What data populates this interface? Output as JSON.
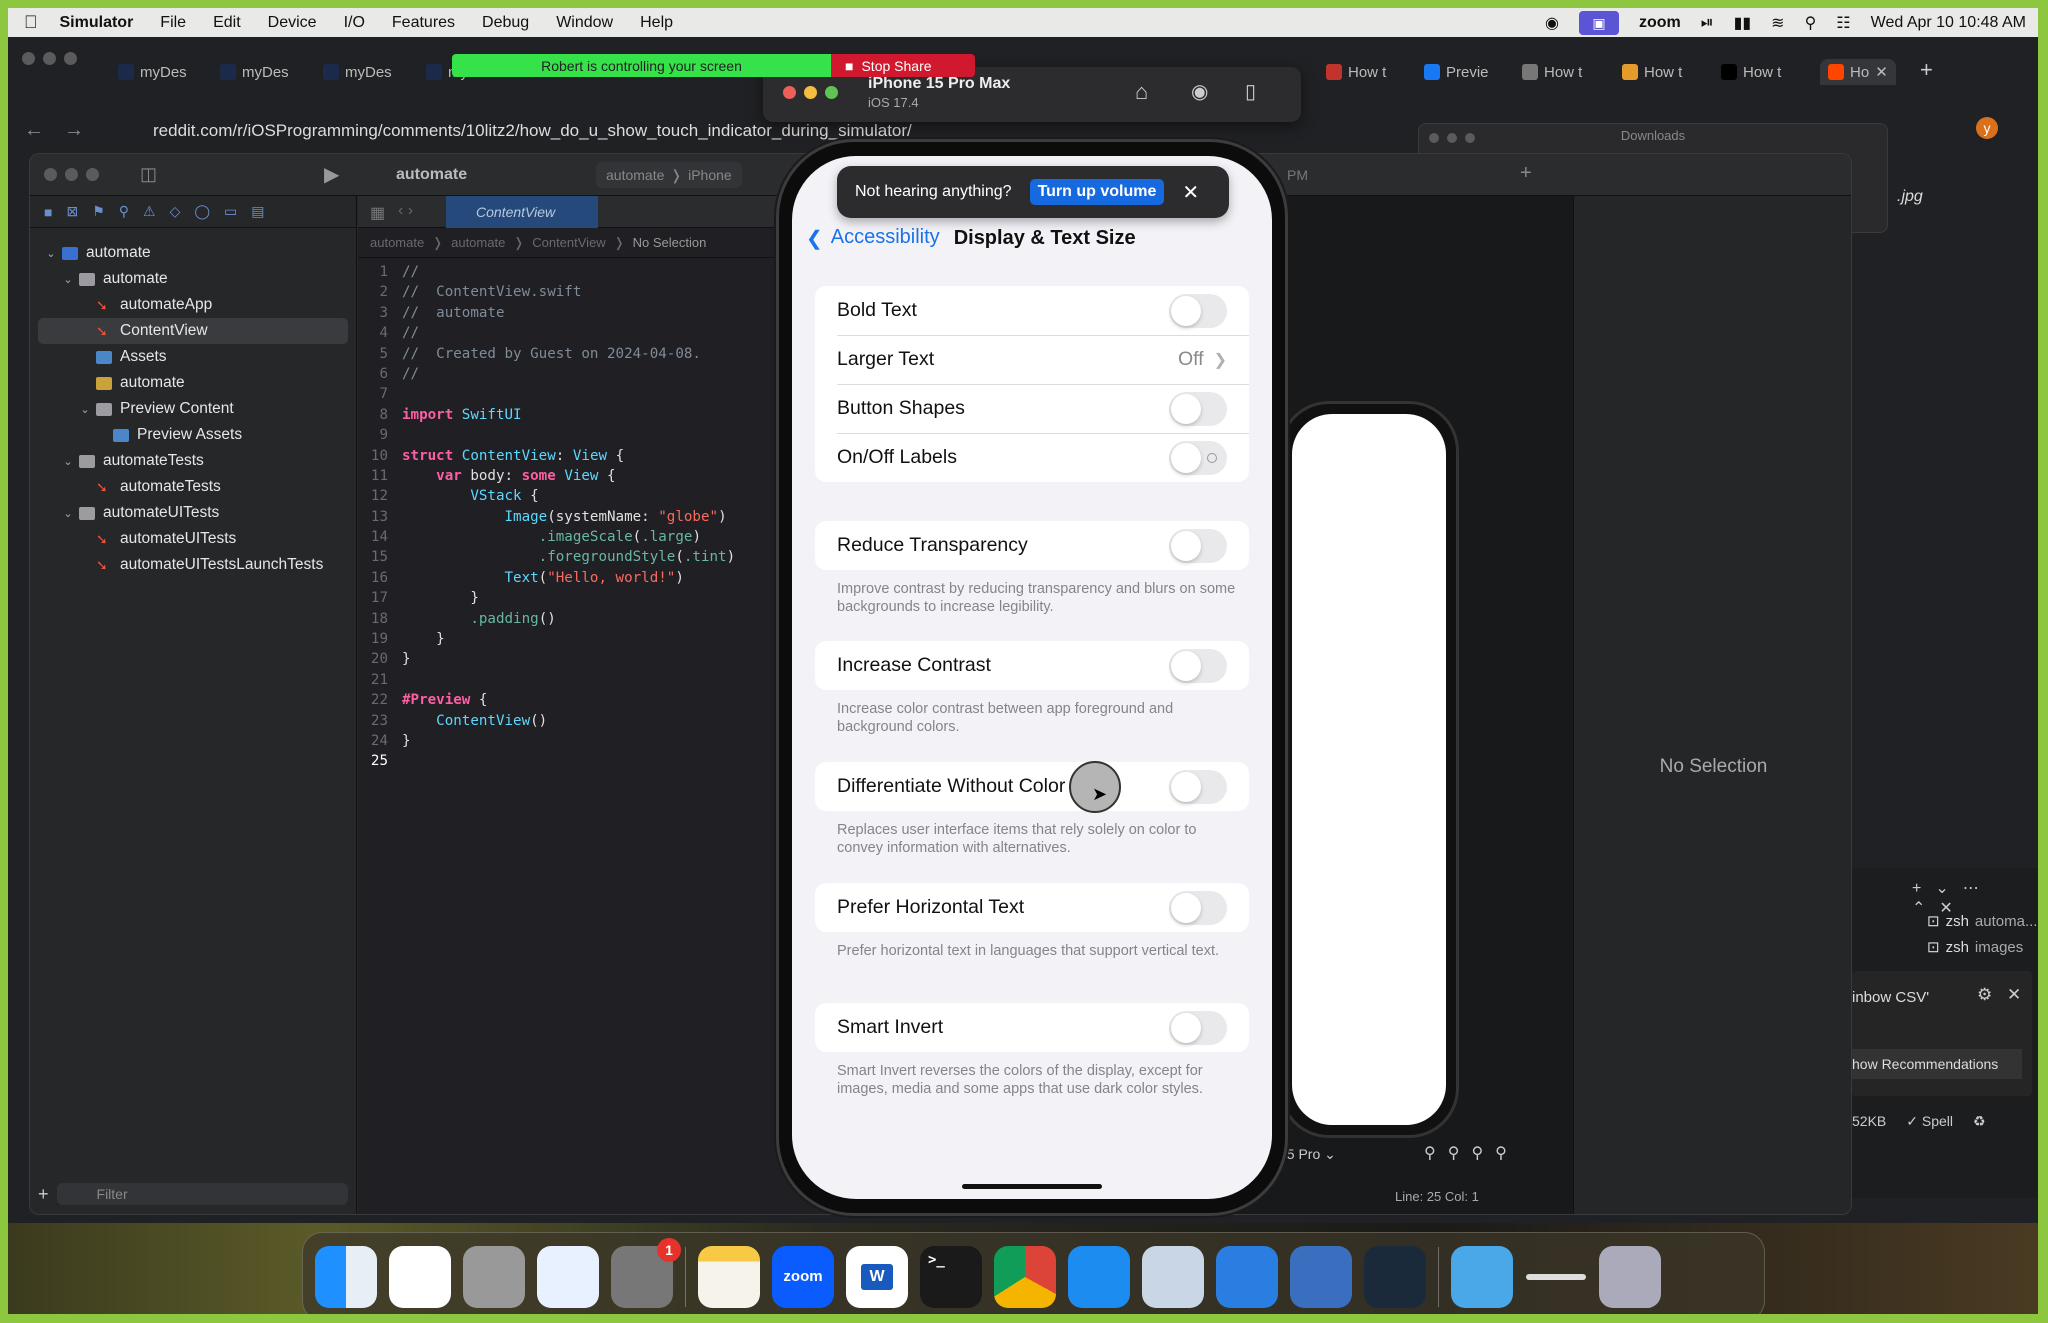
{
  "menubar": {
    "app": "Simulator",
    "items": [
      "File",
      "Edit",
      "Device",
      "I/O",
      "Features",
      "Debug",
      "Window",
      "Help"
    ],
    "zoom_label": "zoom",
    "datetime": "Wed Apr 10  10:48 AM"
  },
  "zoom_share": {
    "message": "Robert is controlling your screen",
    "stop": "Stop Share",
    "color": "#35e24a",
    "stop_color": "#d0192e"
  },
  "browser": {
    "tabs_left": [
      "myDes",
      "myDes",
      "myDes",
      "myDes"
    ],
    "tabs_right": [
      "How t",
      "Previe",
      "How t",
      "How t",
      "How t",
      "Ho"
    ],
    "url": "reddit.com/r/iOSProgramming/comments/10litz2/how_do_u_show_touch_indicator_during_simulator/",
    "new_tab": "+",
    "profile": "y"
  },
  "downloads": {
    "title": "Downloads",
    "file": ".jpg"
  },
  "simulator": {
    "device": "iPhone 15 Pro Max",
    "os": "iOS 17.4"
  },
  "xcode": {
    "project": "automate",
    "scheme": "automate",
    "destination": "iPhone",
    "status_time": "PM",
    "editor_tab": "ContentView",
    "breadcrumb": [
      "automate",
      "automate",
      "ContentView",
      "No Selection"
    ],
    "filter_placeholder": "Filter",
    "navigator": [
      {
        "name": "automate",
        "depth": 0,
        "type": "proj",
        "expanded": true
      },
      {
        "name": "automate",
        "depth": 1,
        "type": "folder",
        "expanded": true
      },
      {
        "name": "automateApp",
        "depth": 2,
        "type": "swift"
      },
      {
        "name": "ContentView",
        "depth": 2,
        "type": "swift",
        "selected": true
      },
      {
        "name": "Assets",
        "depth": 2,
        "type": "assets"
      },
      {
        "name": "automate",
        "depth": 2,
        "type": "ent"
      },
      {
        "name": "Preview Content",
        "depth": 2,
        "type": "folder",
        "expanded": true
      },
      {
        "name": "Preview Assets",
        "depth": 3,
        "type": "assets"
      },
      {
        "name": "automateTests",
        "depth": 1,
        "type": "folder",
        "expanded": true
      },
      {
        "name": "automateTests",
        "depth": 2,
        "type": "swift"
      },
      {
        "name": "automateUITests",
        "depth": 1,
        "type": "folder",
        "expanded": true
      },
      {
        "name": "automateUITests",
        "depth": 2,
        "type": "swift"
      },
      {
        "name": "automateUITestsLaunchTests",
        "depth": 2,
        "type": "swift"
      }
    ],
    "code": [
      "//",
      "//  ContentView.swift",
      "//  automate",
      "//",
      "//  Created by Guest on 2024-04-08.",
      "//",
      "",
      "import SwiftUI",
      "",
      "struct ContentView: View {",
      "    var body: some View {",
      "        VStack {",
      "            Image(systemName: \"globe\")",
      "                .imageScale(.large)",
      "                .foregroundStyle(.tint)",
      "            Text(\"Hello, world!\")",
      "        }",
      "        .padding()",
      "    }",
      "}",
      "",
      "#Preview {",
      "    ContentView()",
      "}",
      ""
    ],
    "current_line": 25,
    "canvas_device": "15 Pro",
    "cursor_position": "Line: 25  Col: 1",
    "inspector": "No Selection"
  },
  "phone": {
    "toast": {
      "message": "Not hearing anything?",
      "button": "Turn up volume"
    },
    "back_label": "Accessibility",
    "title": "Display & Text Size",
    "group1": [
      {
        "label": "Bold Text",
        "on": false
      },
      {
        "label": "Larger Text",
        "value": "Off"
      },
      {
        "label": "Button Shapes",
        "on": false
      },
      {
        "label": "On/Off Labels",
        "on": false
      }
    ],
    "sections": [
      {
        "label": "Reduce Transparency",
        "on": false,
        "footer": "Improve contrast by reducing transparency and blurs on some backgrounds to increase legibility."
      },
      {
        "label": "Increase Contrast",
        "on": false,
        "footer": "Increase color contrast between app foreground and background colors."
      },
      {
        "label": "Differentiate Without Color",
        "on": false,
        "footer": "Replaces user interface items that rely solely on color to convey information with alternatives."
      },
      {
        "label": "Prefer Horizontal Text",
        "on": false,
        "footer": "Prefer horizontal text in languages that support vertical text."
      },
      {
        "label": "Smart Invert",
        "on": false,
        "footer": "Smart Invert reverses the colors of the display, except for images, media and some apps that use dark color styles."
      }
    ],
    "accent": "#1a73e8"
  },
  "vscode": {
    "terminals": [
      {
        "shell": "zsh",
        "name": "automa..."
      },
      {
        "shell": "zsh",
        "name": "images"
      }
    ],
    "notification": "inbow CSV'",
    "notification_button": "how Recommendations",
    "status_size": "52KB",
    "status_spell": "Spell"
  },
  "dock": {
    "apps": [
      "finder",
      "vscode",
      "launchpad",
      "safari",
      "system-settings",
      "notes",
      "zoom",
      "word",
      "terminal",
      "chrome",
      "app-store",
      "preview",
      "xcode",
      "xcode-beta",
      "quicktime",
      "folder",
      "screen-recorder",
      "trash"
    ],
    "settings_badge": "1",
    "zoom_label": "zoom",
    "word_label": "W",
    "terminal_label": ">_"
  }
}
